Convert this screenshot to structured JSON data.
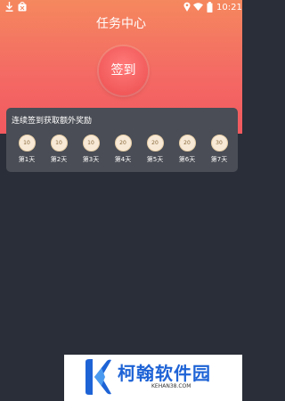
{
  "status_bar": {
    "time": "10:21",
    "icons": [
      "download-icon",
      "bag-icon",
      "location-icon",
      "wifi-icon",
      "battery-icon"
    ]
  },
  "header": {
    "title": "任务中心",
    "gradient_top": "#f5885e",
    "gradient_bottom": "#f2595f"
  },
  "checkin": {
    "label": "签到"
  },
  "rewards": {
    "title": "连续签到获取额外奖励",
    "days": [
      {
        "coins": "10",
        "label": "第1天"
      },
      {
        "coins": "10",
        "label": "第2天"
      },
      {
        "coins": "10",
        "label": "第3天"
      },
      {
        "coins": "20",
        "label": "第4天"
      },
      {
        "coins": "20",
        "label": "第5天"
      },
      {
        "coins": "20",
        "label": "第6天"
      },
      {
        "coins": "30",
        "label": "第7天"
      }
    ]
  },
  "watermark": {
    "name": "柯翰软件园",
    "url": "KEHAN38.COM",
    "color": "#1e63d6"
  },
  "colors": {
    "background": "#2a2e38",
    "card": "#4a4d55",
    "coin": "#f7e9d6"
  }
}
